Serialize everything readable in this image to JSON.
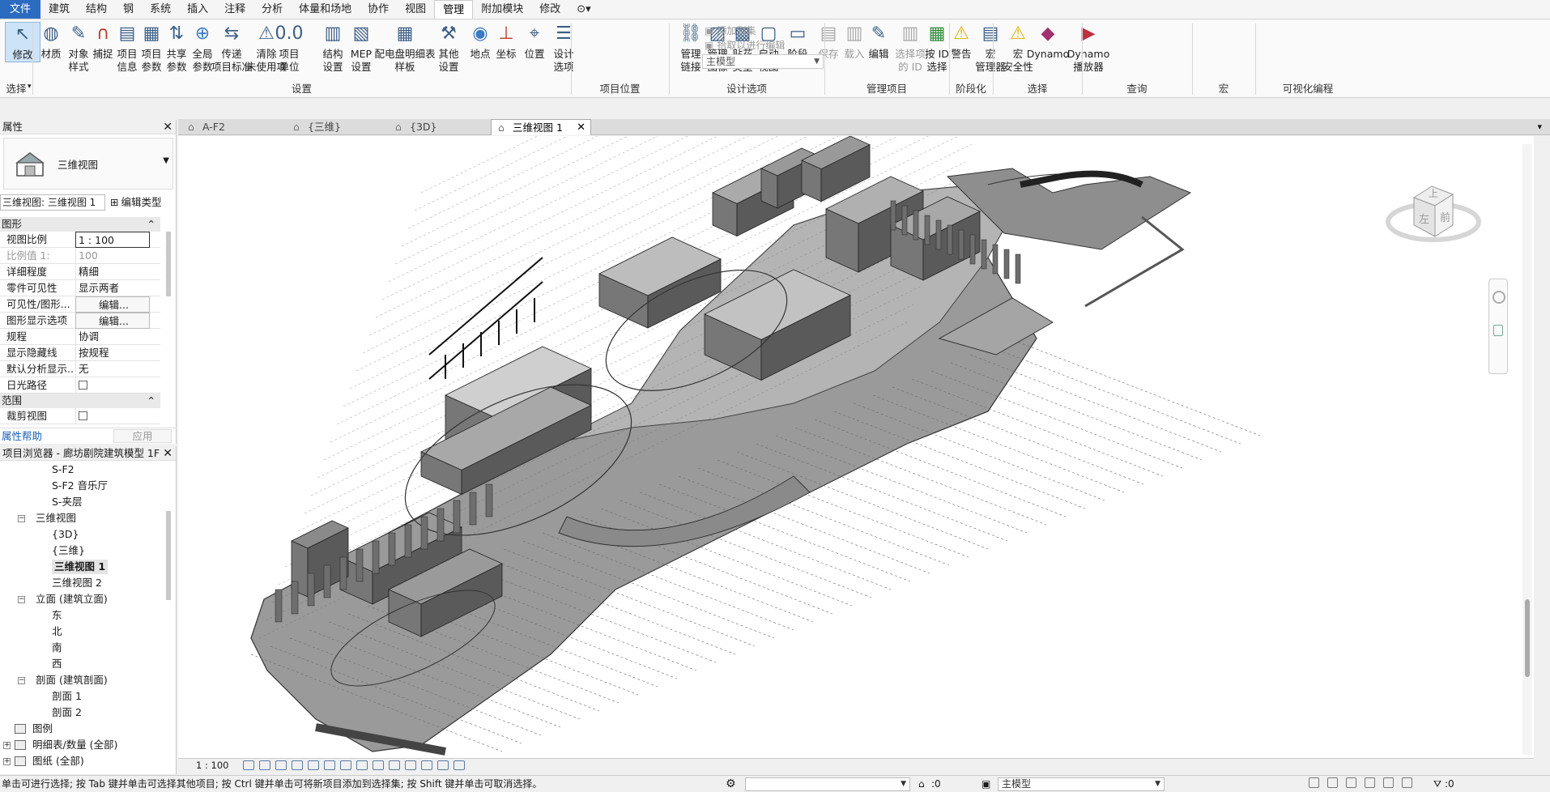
{
  "menubar": {
    "items": [
      "文件",
      "建筑",
      "结构",
      "钢",
      "系统",
      "插入",
      "注释",
      "分析",
      "体量和场地",
      "协作",
      "视图",
      "管理",
      "附加模块",
      "修改"
    ],
    "active": "管理"
  },
  "ribbon": {
    "buttons": [
      {
        "label": "修改",
        "id": "modify"
      },
      {
        "label": "材质",
        "id": "materials"
      },
      {
        "label": "对象\n样式",
        "id": "object-styles"
      },
      {
        "label": "捕捉",
        "id": "snaps"
      },
      {
        "label": "项目\n信息",
        "id": "project-info"
      },
      {
        "label": "项目\n参数",
        "id": "project-params"
      },
      {
        "label": "共享\n参数",
        "id": "shared-params"
      },
      {
        "label": "全局\n参数",
        "id": "global-params"
      },
      {
        "label": "传递\n项目标准",
        "id": "transfer-standards"
      },
      {
        "label": "清除\n未使用项",
        "id": "purge-unused"
      },
      {
        "label": "项目\n单位",
        "id": "project-units"
      },
      {
        "label": "结构\n设置",
        "id": "structural-settings"
      },
      {
        "label": "MEP\n设置",
        "id": "mep-settings"
      },
      {
        "label": "配电盘明细表\n样板",
        "id": "panel-schedule"
      },
      {
        "label": "其他\n设置",
        "id": "other-settings"
      },
      {
        "label": "地点",
        "id": "location"
      },
      {
        "label": "坐标",
        "id": "coordinates"
      },
      {
        "label": "位置",
        "id": "position"
      },
      {
        "label": "设计\n选项",
        "id": "design-options"
      },
      {
        "label": "管理\n链接",
        "id": "manage-links"
      },
      {
        "label": "管理\n图像",
        "id": "manage-images"
      },
      {
        "label": "贴花\n类型",
        "id": "decal-types"
      },
      {
        "label": "启动\n视图",
        "id": "starting-view"
      },
      {
        "label": "阶段",
        "id": "phases"
      },
      {
        "label": "保存",
        "id": "save"
      },
      {
        "label": "载入",
        "id": "load"
      },
      {
        "label": "编辑",
        "id": "edit"
      },
      {
        "label": "选择项\n的 ID",
        "id": "ids-of-selection"
      },
      {
        "label": "按 ID\n选择",
        "id": "select-by-id"
      },
      {
        "label": "警告",
        "id": "warnings"
      },
      {
        "label": "宏\n管理器",
        "id": "macro-manager"
      },
      {
        "label": "宏\n安全性",
        "id": "macro-security"
      },
      {
        "label": "Dynamo",
        "id": "dynamo"
      },
      {
        "label": "Dynamo\n播放器",
        "id": "dynamo-player"
      }
    ],
    "add_to_set": "添加到集",
    "pick_to_edit": "拾取以进行编辑",
    "main_model": "主模型",
    "groups": [
      "选择",
      "设置",
      "项目位置",
      "设计选项",
      "管理项目",
      "阶段化",
      "选择",
      "查询",
      "宏",
      "可视化编程"
    ]
  },
  "properties": {
    "title": "属性",
    "type_name": "三维视图",
    "selector": "三维视图: 三维视图 1",
    "edit_type": "编辑类型",
    "section_graphics": "图形",
    "rows": [
      {
        "k": "视图比例",
        "v": "1 : 100"
      },
      {
        "k": "比例值 1:",
        "v": "100"
      },
      {
        "k": "详细程度",
        "v": "精细"
      },
      {
        "k": "零件可见性",
        "v": "显示两者"
      },
      {
        "k": "可见性/图形...",
        "v": "编辑..."
      },
      {
        "k": "图形显示选项",
        "v": "编辑..."
      },
      {
        "k": "规程",
        "v": "协调"
      },
      {
        "k": "显示隐藏线",
        "v": "按规程"
      },
      {
        "k": "默认分析显示...",
        "v": "无"
      },
      {
        "k": "日光路径",
        "v": ""
      }
    ],
    "section_extents": "范围",
    "crop_view": "裁剪视图",
    "help": "属性帮助",
    "apply": "应用"
  },
  "browser": {
    "title": "项目浏览器 - 廊坊剧院建筑模型 1F",
    "nodes": [
      {
        "label": "S-F2",
        "level": 2
      },
      {
        "label": "S-F2 音乐厅",
        "level": 2
      },
      {
        "label": "S-夹层",
        "level": 2
      },
      {
        "label": "三维视图",
        "level": 1,
        "toggle": "−"
      },
      {
        "label": "{3D}",
        "level": 2
      },
      {
        "label": "{三维}",
        "level": 2
      },
      {
        "label": "三维视图 1",
        "level": 2,
        "selected": true
      },
      {
        "label": "三维视图 2",
        "level": 2
      },
      {
        "label": "立面 (建筑立面)",
        "level": 1,
        "toggle": "−"
      },
      {
        "label": "东",
        "level": 2
      },
      {
        "label": "北",
        "level": 2
      },
      {
        "label": "南",
        "level": 2
      },
      {
        "label": "西",
        "level": 2
      },
      {
        "label": "剖面 (建筑剖面)",
        "level": 1,
        "toggle": "−"
      },
      {
        "label": "剖面 1",
        "level": 2
      },
      {
        "label": "剖面 2",
        "level": 2
      },
      {
        "label": "图例",
        "level": 0
      },
      {
        "label": "明细表/数量 (全部)",
        "level": 0,
        "toggle": "+"
      },
      {
        "label": "图纸 (全部)",
        "level": 0,
        "toggle": "+"
      }
    ]
  },
  "tabs": [
    "A-F2",
    "{三维}",
    "{3D}",
    "三维视图 1"
  ],
  "viewcube": {
    "top": "上",
    "left": "左",
    "front": "前"
  },
  "viewbar": {
    "scale": "1 : 100"
  },
  "status": {
    "message": "单击可进行选择; 按 Tab 键并单击可选择其他项目; 按 Ctrl 键并单击可将新项目添加到选择集; 按 Shift 键并单击可取消选择。",
    "worksets": ":0",
    "model": "主模型",
    "filter": ":0"
  }
}
